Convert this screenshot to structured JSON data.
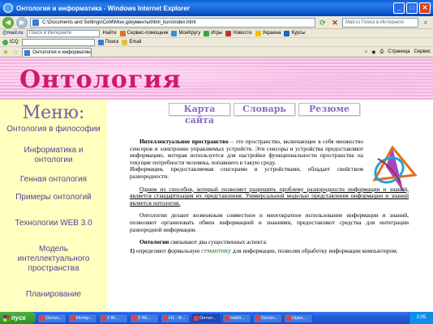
{
  "window": {
    "title": "Онтология и информатика - Windows Internet Explorer",
    "minimize": "_",
    "maximize": "□",
    "close": "✕"
  },
  "address": {
    "url": "C:\\Documents and Settings\\CoM\\Мои документы\\html_kurs\\index.html",
    "search_placeholder": "Mail.ru Поиск в Интернете"
  },
  "toolbar1": {
    "logo": "@mail.ru",
    "search_placeholder": "Поиск в Интернете",
    "find": "Найти",
    "items": [
      "Сервис-помощник",
      "МоиКругу",
      "Игры",
      "Новости",
      "Украина",
      "Курсы"
    ]
  },
  "toolbar2": {
    "icq": "ICQ",
    "search": "Поиск",
    "email": "Email"
  },
  "tabs": {
    "active": "Онтология и информатика",
    "page_cmd": "Страница",
    "tools_cmd": "Сервис"
  },
  "page": {
    "banner_title": "Онтология",
    "menu_title": "Меню:",
    "menu_items": [
      "Онтология в философии",
      "Информатика и онтологии",
      "Генная онтология",
      "Примеры онтологий",
      "Технологии WEB 3.0",
      "Модель интеллектуального пространства",
      "Планирование"
    ],
    "nav_buttons": [
      "Карта сайта",
      "Словарь",
      "Резюме"
    ],
    "para1_bold": "Интеллектуальное пространство",
    "para1_rest": " – это пространство, включающее в себя множество сенсоров и электронно управляемых устройств. Эти сенсоры и устройства предоставляют информацию, которая используется для настройки функциональности пространства на текущие потребности человека, попавшего в такую среду.",
    "para2": "Информация, предоставляемая сенсорами и устройствами, обладает свойством разнородности.",
    "para3": "Одним из способов, который позволяет разрешить проблему разнородности информации и знаний, является стандартизация их представления. Универсальной моделью представления информации и знаний является онтология.",
    "para4": "Онтологии делают возможным совместное и многократное использование информации и знаний, позволяют организовать обмен информацией и знаниями, предоставляют средства для интеграции разнородной информации.",
    "para5_bold": "Онтологии",
    "para5_rest": " связывают два существенных аспекта:",
    "para6_num": "1)",
    "para6_a": " определяют формальную ",
    "para6_hl": "семантику",
    "para6_b": " для информации, позволяя обработку информации компьютером."
  },
  "taskbar": {
    "start": "пуск",
    "items": [
      "Онтол...",
      "Интер...",
      "2 W...",
      "2 Wi...",
      "Н1 - Ф...",
      "Онтол...",
      "Intelli...",
      "Онтол...",
      "Нужн..."
    ],
    "clock": "2:05"
  }
}
